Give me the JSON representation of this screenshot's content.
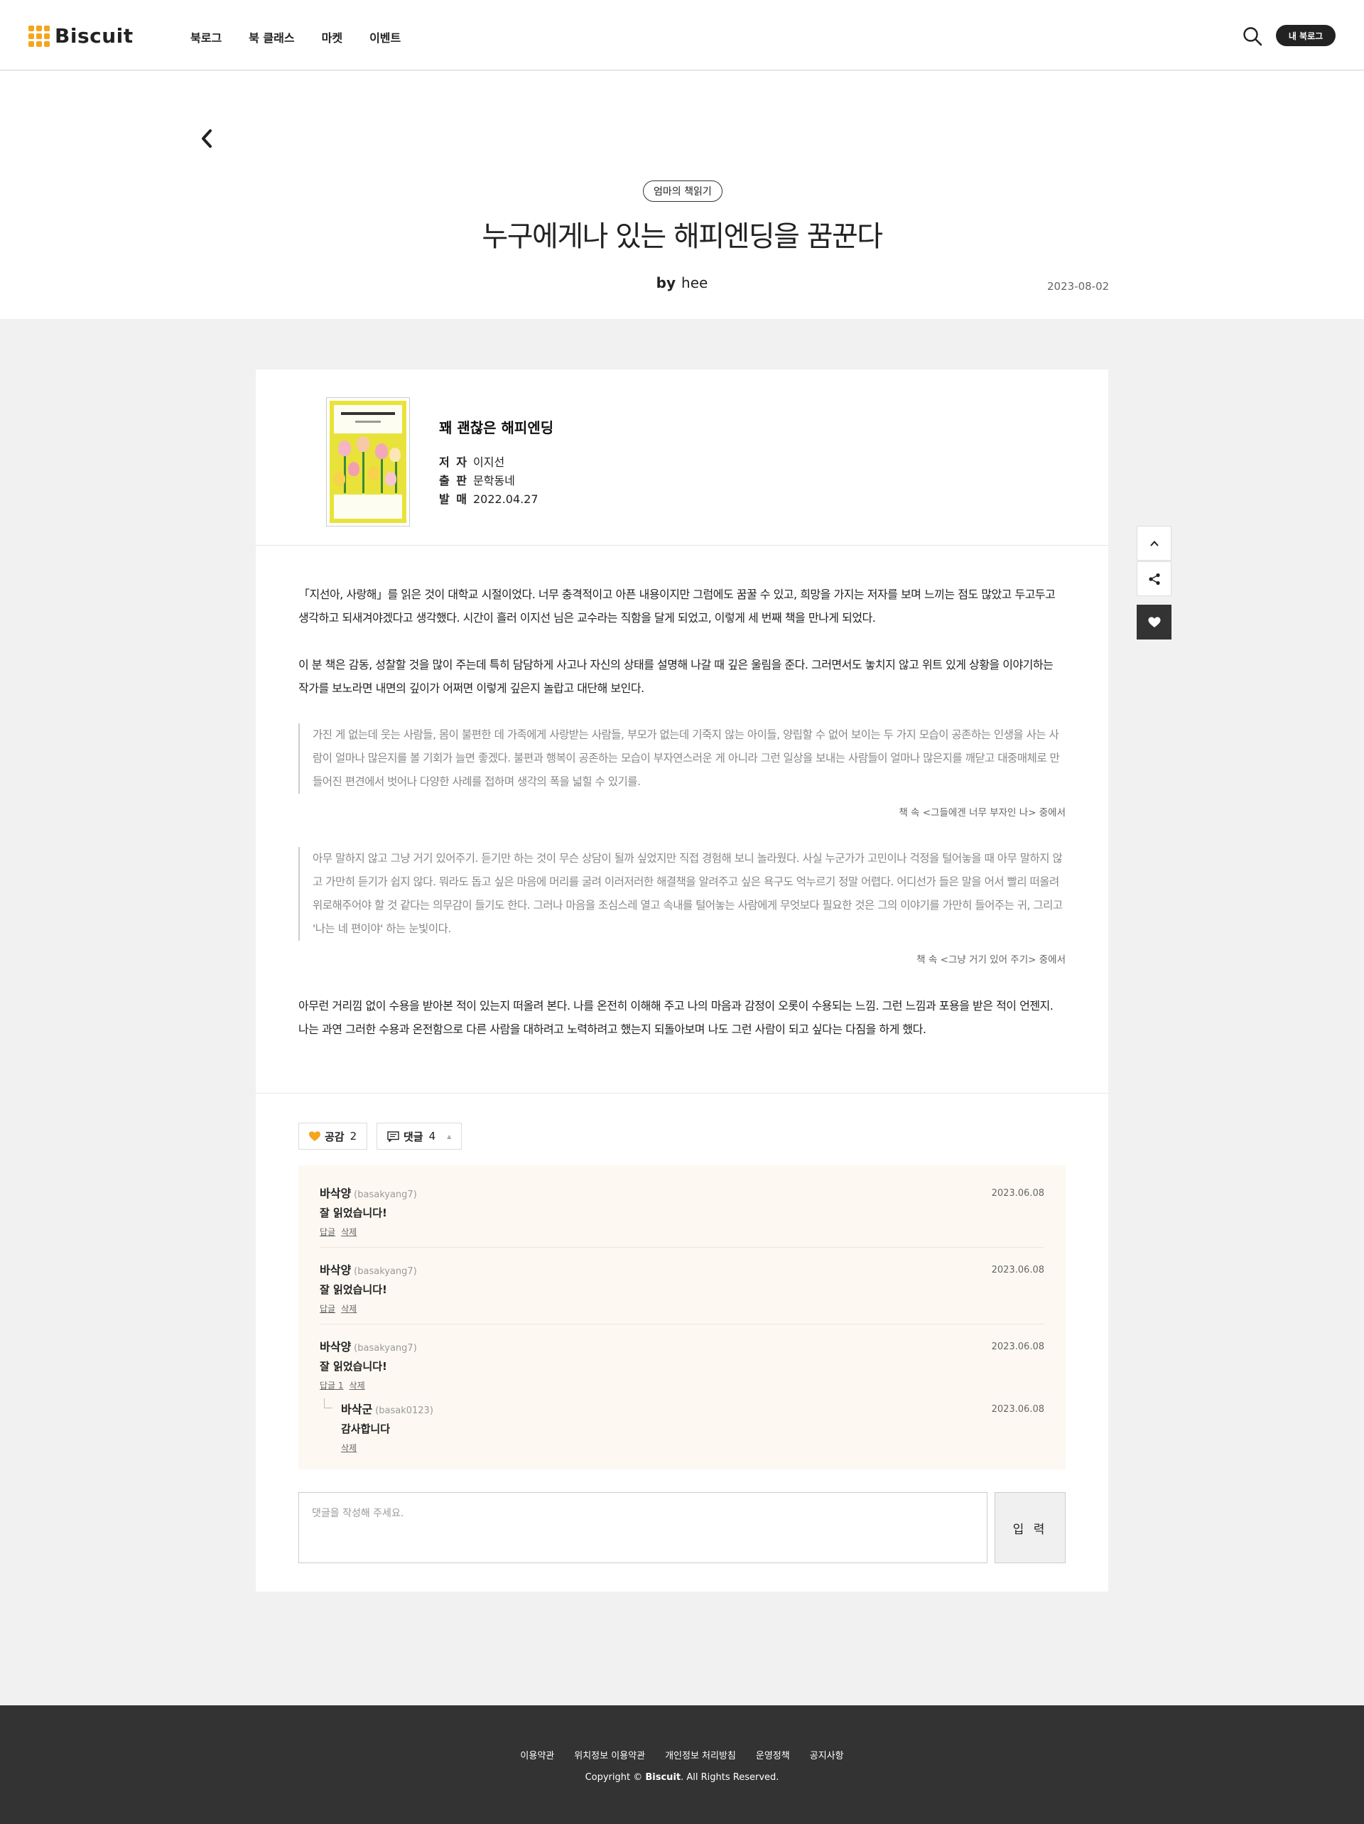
{
  "header": {
    "logo_text": "Biscuit",
    "nav": [
      "북로그",
      "북 클래스",
      "마켓",
      "이벤트"
    ],
    "my_blog_label": "내 북로그"
  },
  "post": {
    "category": "엄마의 책읽기",
    "title": "누구에게나 있는 해피엔딩을 꿈꾼다",
    "by_label": "by",
    "author": "hee",
    "date": "2023-08-02"
  },
  "book": {
    "title": "꽤 괜찮은 해피엔딩",
    "author_label": "저 자",
    "author": "이지선",
    "publisher_label": "출 판",
    "publisher": "문학동네",
    "release_label": "발 매",
    "release_date": "2022.04.27"
  },
  "body": {
    "p1": "「지선아, 사랑해」를 읽은 것이 대학교 시절이었다. 너무 충격적이고 아픈 내용이지만 그럼에도 꿈꿀 수 있고, 희망을 가지는 저자를 보며 느끼는 점도 많았고 두고두고 생각하고 되새겨야겠다고 생각했다. 시간이 흘러 이지선 님은 교수라는 직함을 달게 되었고, 이렇게 세 번째 책을 만나게 되었다.",
    "p2": "이 분 책은 감동, 성찰할 것을 많이 주는데 특히 담담하게 사고나 자신의 상태를 설명해 나갈 때 깊은 울림을 준다. 그러면서도 놓치지 않고 위트 있게 상황을 이야기하는 작가를 보노라면 내면의 깊이가 어쩌면 이렇게 깊은지 놀랍고 대단해 보인다.",
    "quote1": "가진 게 없는데 웃는 사람들, 몸이 불편한 데 가족에게 사랑받는 사람들, 부모가 없는데 기죽지 않는 아이들, 양립할 수 없어 보이는 두 가지 모습이 공존하는 인생을 사는 사람이 얼마나 많은지를 볼 기회가 늘면 좋겠다. 불편과 행복이 공존하는 모습이 부자연스러운 게 아니라 그런 일상을 보내는 사람들이 얼마나 많은지를 깨닫고 대중매체로 만들어진 편견에서 벗어나 다양한 사례를 접하며 생각의 폭을 넓힐 수 있기를.",
    "quote1_source": "책 속  <그들에겐 너무 부자인 나> 중에서",
    "quote2": "아무 말하지 않고 그냥 거기 있어주기. 듣기만 하는 것이 무슨 상담이 될까 싶었지만 직접 경험해 보니 놀라웠다. 사실 누군가가 고민이나 걱정을 털어놓을 때 아무 말하지 않고 가만히 듣기가 쉽지 않다. 뭐라도 돕고 싶은 마음에 머리를 굴려 이러저러한 해결책을 알려주고 싶은 욕구도 억누르기 정말 어렵다. 어디선가 들은 말을 어서 빨리 떠올려 위로해주어야 할 것 같다는 의무감이 들기도 한다. 그러나 마음을 조심스레 열고 속내를 털어놓는 사람에게 무엇보다 필요한 것은 그의 이야기를 가만히 들어주는 귀, 그리고 '나는 네 편이야' 하는 눈빛이다.",
    "quote2_source": "책 속  <그냥 거기 있어 주기> 중에서",
    "p3": "아무런 거리낌 없이 수용을 받아본 적이 있는지 떠올려 본다. 나를 온전히 이해해 주고 나의 마음과 감정이 오롯이 수용되는 느낌. 그런 느낌과 포용을 받은 적이 언젠지. 나는 과연 그러한 수용과 온전함으로 다른 사람을 대하려고 노력하려고 했는지 되돌아보며 나도 그런 사람이 되고 싶다는 다짐을 하게 했다."
  },
  "reactions": {
    "like_label": "공감",
    "like_count": "2",
    "comment_label": "댓글",
    "comment_count": "4"
  },
  "comments": [
    {
      "name": "바삭양",
      "id": "(basakyang7)",
      "text": "잘 읽었습니다!",
      "date": "2023.06.08",
      "reply_label": "답글",
      "delete_label": "삭제"
    },
    {
      "name": "바삭양",
      "id": "(basakyang7)",
      "text": "잘 읽었습니다!",
      "date": "2023.06.08",
      "reply_label": "답글",
      "delete_label": "삭제"
    },
    {
      "name": "바삭양",
      "id": "(basakyang7)",
      "text": "잘 읽었습니다!",
      "date": "2023.06.08",
      "reply_label": "답글 1",
      "delete_label": "삭제"
    },
    {
      "name": "바삭군",
      "id": "(basak0123)",
      "text": "감사합니다",
      "date": "2023.06.08",
      "delete_label": "삭제"
    }
  ],
  "comment_form": {
    "placeholder": "댓글을 작성해 주세요.",
    "submit_label": "입 력"
  },
  "footer": {
    "links": [
      "이용약관",
      "위치정보 이용약관",
      "개인정보 처리방침",
      "운영정책",
      "공지사항"
    ],
    "copyright_prefix": "Copyright ©",
    "copyright_brand": "Biscuit",
    "copyright_suffix": ". All Rights Reserved."
  },
  "colors": {
    "brand": "#f5a41b",
    "dark": "#333333",
    "comment_bg": "#fdf9f2"
  }
}
